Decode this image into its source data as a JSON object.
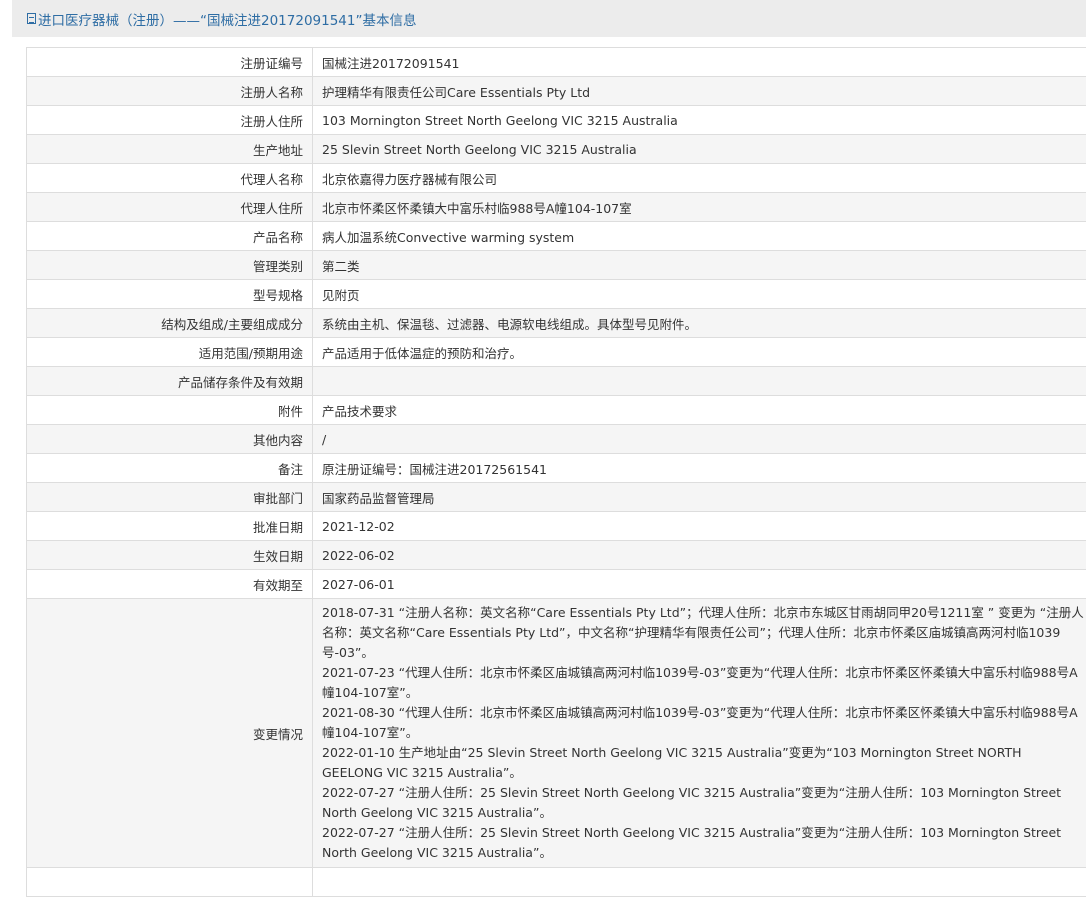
{
  "header": {
    "title": "进口医疗器械（注册）——“国械注进20172091541”基本信息"
  },
  "rows": [
    {
      "label": "注册证编号",
      "value": "国械注进20172091541"
    },
    {
      "label": "注册人名称",
      "value": "护理精华有限责任公司Care Essentials Pty Ltd"
    },
    {
      "label": "注册人住所",
      "value": "103 Mornington Street North Geelong VIC 3215 Australia"
    },
    {
      "label": "生产地址",
      "value": "25 Slevin Street North Geelong VIC 3215 Australia"
    },
    {
      "label": "代理人名称",
      "value": "北京依嘉得力医疗器械有限公司"
    },
    {
      "label": "代理人住所",
      "value": "北京市怀柔区怀柔镇大中富乐村临988号A幢104-107室"
    },
    {
      "label": "产品名称",
      "value": "病人加温系统Convective warming system"
    },
    {
      "label": "管理类别",
      "value": "第二类"
    },
    {
      "label": "型号规格",
      "value": "见附页"
    },
    {
      "label": "结构及组成/主要组成成分",
      "value": "系统由主机、保温毯、过滤器、电源软电线组成。具体型号见附件。"
    },
    {
      "label": "适用范围/预期用途",
      "value": "产品适用于低体温症的预防和治疗。"
    },
    {
      "label": "产品储存条件及有效期",
      "value": ""
    },
    {
      "label": "附件",
      "value": "产品技术要求"
    },
    {
      "label": "其他内容",
      "value": "/"
    },
    {
      "label": "备注",
      "value": "原注册证编号：国械注进20172561541"
    },
    {
      "label": "审批部门",
      "value": "国家药品监督管理局"
    },
    {
      "label": "批准日期",
      "value": "2021-12-02"
    },
    {
      "label": "生效日期",
      "value": "2022-06-02"
    },
    {
      "label": "有效期至",
      "value": "2027-06-01"
    }
  ],
  "changes": {
    "label": "变更情况",
    "entries": [
      "2018-07-31 “注册人名称：英文名称“Care Essentials Pty Ltd”；代理人住所：北京市东城区甘雨胡同甲20号1211室 ” 变更为 “注册人名称：英文名称“Care Essentials Pty Ltd”，中文名称“护理精华有限责任公司”；代理人住所：北京市怀柔区庙城镇高两河村临1039号-03”。",
      "2021-07-23 “代理人住所：北京市怀柔区庙城镇高两河村临1039号-03”变更为“代理人住所：北京市怀柔区怀柔镇大中富乐村临988号A幢104-107室”。",
      "2021-08-30 “代理人住所：北京市怀柔区庙城镇高两河村临1039号-03”变更为“代理人住所：北京市怀柔区怀柔镇大中富乐村临988号A幢104-107室”。",
      "2022-01-10 生产地址由“25 Slevin Street North Geelong VIC 3215 Australia”变更为“103 Mornington Street NORTH GEELONG VIC 3215 Australia”。",
      "2022-07-27 “注册人住所：25 Slevin Street North Geelong VIC 3215 Australia”变更为“注册人住所：103 Mornington Street North Geelong VIC 3215 Australia”。",
      "2022-07-27 “注册人住所：25 Slevin Street North Geelong VIC 3215 Australia”变更为“注册人住所：103 Mornington Street North Geelong VIC 3215 Australia”。"
    ]
  }
}
